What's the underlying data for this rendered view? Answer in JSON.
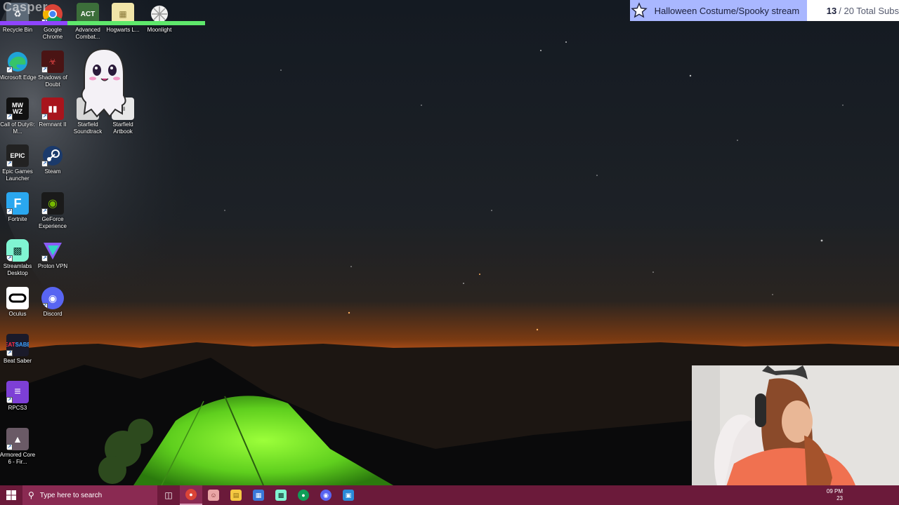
{
  "overlay": {
    "streamer_name": "Casper",
    "goal": {
      "title": "Halloween Costume/Spooky stream",
      "current": "13",
      "target_text": "/ 20 Total Subs"
    }
  },
  "desktop_icons": [
    {
      "label": "Recycle Bin",
      "icon": "recycle-bin-icon"
    },
    {
      "label": "Google Chrome",
      "icon": "chrome-icon"
    },
    {
      "label": "Advanced Combat...",
      "icon": "act-icon"
    },
    {
      "label": "Hogwarts L...",
      "icon": "hogwarts-icon"
    },
    {
      "label": "Moonlight",
      "icon": "moonlight-icon"
    },
    {
      "label": "Microsoft Edge",
      "icon": "edge-icon"
    },
    {
      "label": "Shadows of Doubt",
      "icon": "shadows-of-doubt-icon"
    },
    {
      "label": "Call of Duty®: M...",
      "icon": "call-of-duty-icon"
    },
    {
      "label": "Remnant II",
      "icon": "remnant-icon"
    },
    {
      "label": "Starfield Soundtrack",
      "icon": "starfield-soundtrack-icon"
    },
    {
      "label": "Starfield Artbook",
      "icon": "starfield-artbook-icon"
    },
    {
      "label": "Epic Games Launcher",
      "icon": "epic-games-icon"
    },
    {
      "label": "Steam",
      "icon": "steam-icon"
    },
    {
      "label": "Fortnite",
      "icon": "fortnite-icon"
    },
    {
      "label": "GeForce Experience",
      "icon": "geforce-icon"
    },
    {
      "label": "Streamlabs Desktop",
      "icon": "streamlabs-icon"
    },
    {
      "label": "Proton VPN",
      "icon": "proton-vpn-icon"
    },
    {
      "label": "Oculus",
      "icon": "oculus-icon"
    },
    {
      "label": "Discord",
      "icon": "discord-icon"
    },
    {
      "label": "Beat Saber",
      "icon": "beat-saber-icon"
    },
    {
      "label": "RPCS3",
      "icon": "rpcs3-icon"
    },
    {
      "label": "Armored Core 6 - Fir...",
      "icon": "armored-core-icon"
    }
  ],
  "taskbar": {
    "search_placeholder": "Type here to search",
    "time": "09 PM",
    "date": "23"
  },
  "colors": {
    "taskbar_bg": "#6b1a3a",
    "goal_accent": "#a9b7ff",
    "bar_purple": "#8e44ff",
    "bar_green": "#5ee86b"
  }
}
